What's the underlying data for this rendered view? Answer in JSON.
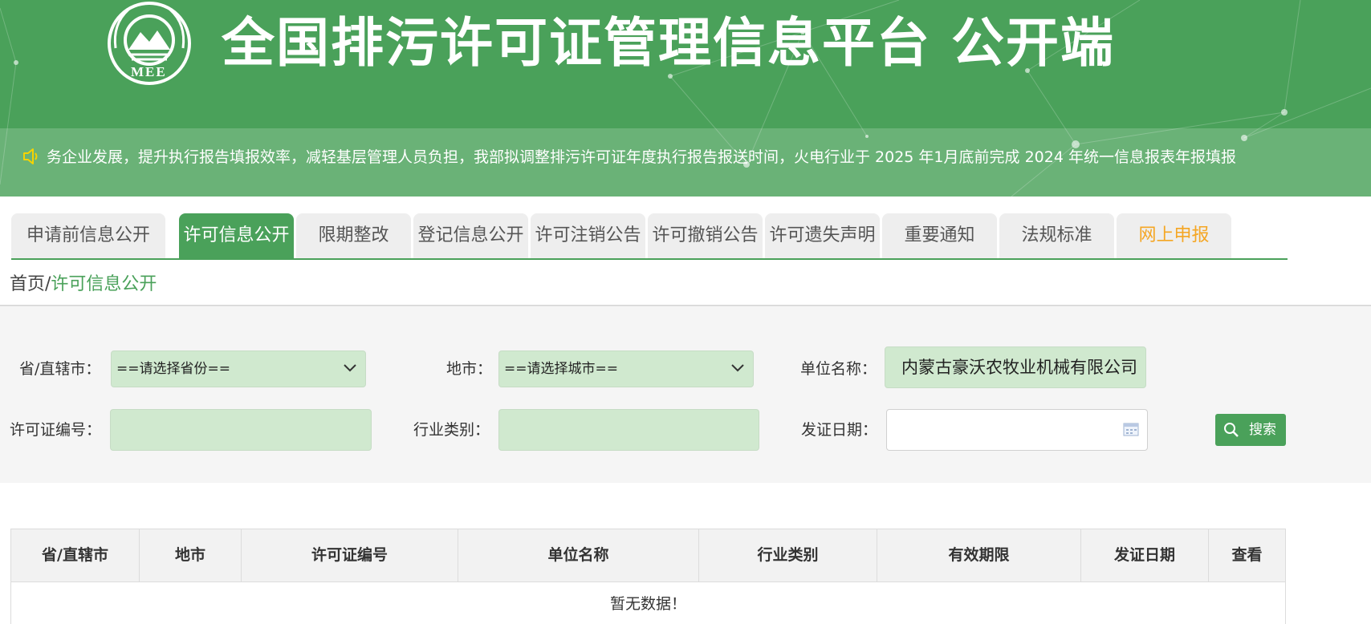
{
  "header": {
    "logo_text": "MEE",
    "title": "全国排污许可证管理信息平台  公开端",
    "notice_icon": "speaker-icon",
    "notice": "务企业发展，提升执行报告填报效率，减轻基层管理人员负担，我部拟调整排污许可证年度执行报告报送时间，火电行业于 2025 年1月底前完成 2024 年统一信息报表年报填报"
  },
  "tabs": [
    {
      "label": "申请前信息公开"
    },
    {
      "label": "许可信息公开"
    },
    {
      "label": "限期整改"
    },
    {
      "label": "登记信息公开"
    },
    {
      "label": "许可注销公告"
    },
    {
      "label": "许可撤销公告"
    },
    {
      "label": "许可遗失声明"
    },
    {
      "label": "重要通知"
    },
    {
      "label": "法规标准"
    },
    {
      "label": "网上申报"
    }
  ],
  "breadcrumb": {
    "home": "首页/",
    "current": "许可信息公开"
  },
  "search": {
    "province_label": "省/直辖市：",
    "province_value": "==请选择省份==",
    "city_label": "地市：",
    "city_value": "==请选择城市==",
    "company_label": "单位名称：",
    "company_value": "内蒙古豪沃农牧业机械有限公司",
    "license_label": "许可证编号：",
    "license_value": "",
    "industry_label": "行业类别：",
    "industry_value": "",
    "date_label": "发证日期：",
    "date_value": "",
    "search_button": "搜索"
  },
  "table": {
    "headers": [
      "省/直辖市",
      "地市",
      "许可证编号",
      "单位名称",
      "行业类别",
      "有效期限",
      "发证日期",
      "查看"
    ],
    "empty_text": "暂无数据！"
  },
  "colors": {
    "brand_green": "#4aa15a",
    "field_green": "#d0e9cf",
    "tab_orange": "#f5a623"
  }
}
